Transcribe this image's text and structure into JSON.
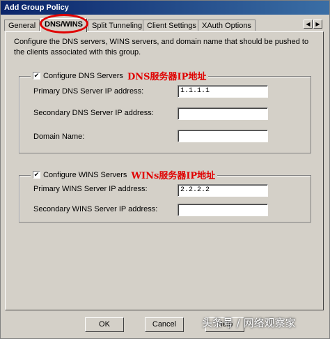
{
  "window": {
    "title": "Add Group Policy"
  },
  "tabs": [
    {
      "label": "General"
    },
    {
      "label": "DNS/WINS"
    },
    {
      "label": "Split Tunneling"
    },
    {
      "label": "Client Settings"
    },
    {
      "label": "XAuth Options"
    }
  ],
  "tab_scroll": {
    "left": "◀",
    "right": "▶"
  },
  "description": "Configure the DNS servers, WINS servers, and domain name that should be pushed to the clients associated with this group.",
  "dns": {
    "checkbox_label": "Configure DNS Servers",
    "checked": true,
    "annotation": "DNS服务器IP地址",
    "primary_label": "Primary DNS Server IP address:",
    "primary_value": "1.1.1.1",
    "secondary_label": "Secondary DNS Server IP address:",
    "secondary_value": "",
    "domain_label": "Domain Name:",
    "domain_value": ""
  },
  "wins": {
    "checkbox_label": "Configure WINS Servers",
    "checked": true,
    "annotation": "WINs服务器IP地址",
    "primary_label": "Primary WINS Server IP address:",
    "primary_value": "2.2.2.2",
    "secondary_label": "Secondary WINS Server IP address:",
    "secondary_value": ""
  },
  "buttons": {
    "ok": "OK",
    "cancel": "Cancel",
    "help": "Help"
  },
  "checkmark": "✔",
  "watermark": "头条号 / 网络观察家",
  "colors": {
    "annotation": "#e00000",
    "titlebar": "#0a246a",
    "face": "#d4d0c8"
  }
}
